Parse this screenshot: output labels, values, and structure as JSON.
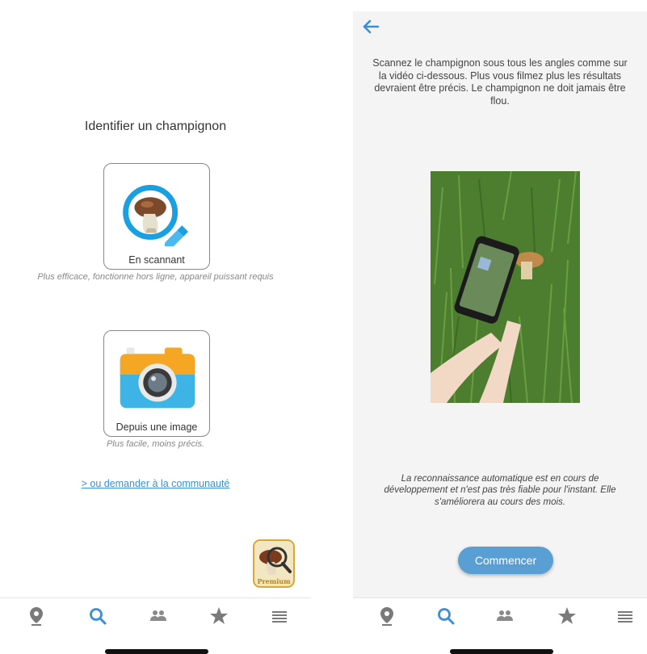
{
  "left_screen": {
    "title": "Identifier un champignon",
    "scan_option": {
      "label": "En scannant",
      "subtext": "Plus efficace, fonctionne hors ligne, appareil puissant requis"
    },
    "image_option": {
      "label": "Depuis une image",
      "subtext": "Plus facile, moins précis."
    },
    "community_link": "> ou demander à la communauté",
    "premium_badge": "Premium"
  },
  "right_screen": {
    "instructions": "Scannez le champignon sous tous les angles comme sur la vidéo ci-dessous. Plus vous filmez plus les résultats devraient être précis. Le champignon ne doit jamais être flou.",
    "disclaimer": "La reconnaissance automatique est en cours de développement et n'est pas très fiable pour l'instant. Elle s'améliorera au cours des mois.",
    "start_button": "Commencer"
  },
  "tab_bar": {
    "tabs": [
      {
        "icon": "map-pin-icon",
        "active": false
      },
      {
        "icon": "search-icon",
        "active": true
      },
      {
        "icon": "community-icon",
        "active": false
      },
      {
        "icon": "star-icon",
        "active": false
      },
      {
        "icon": "menu-icon",
        "active": false
      }
    ],
    "active_color": "#3c8fd6",
    "inactive_color": "#7a7a7a"
  },
  "colors": {
    "accent": "#3c8fd6",
    "button": "#5a9fd4",
    "premium_gold": "#d4a93a"
  }
}
